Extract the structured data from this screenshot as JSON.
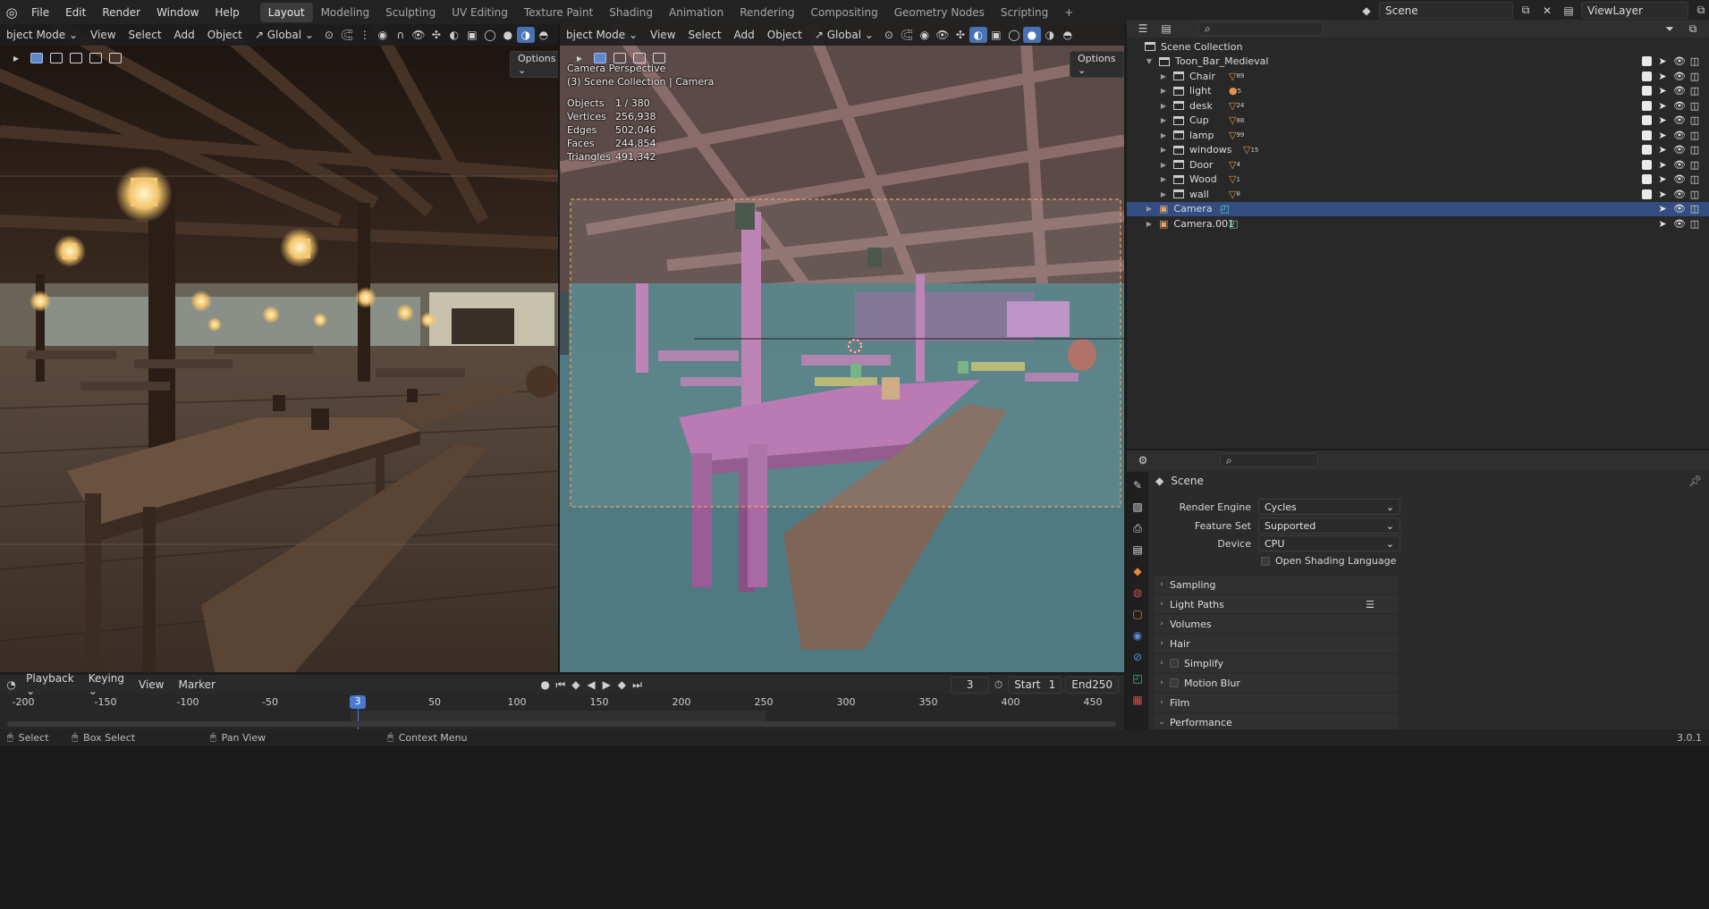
{
  "menu": [
    "File",
    "Edit",
    "Render",
    "Window",
    "Help"
  ],
  "workspaces": [
    "Layout",
    "Modeling",
    "Sculpting",
    "UV Editing",
    "Texture Paint",
    "Shading",
    "Animation",
    "Rendering",
    "Compositing",
    "Geometry Nodes",
    "Scripting"
  ],
  "active_workspace": "Layout",
  "add_workspace": "+",
  "scene_field": "Scene",
  "viewlayer_field": "ViewLayer",
  "viewport_left": {
    "mode": "bject Mode",
    "menus": [
      "View",
      "Select",
      "Add",
      "Object"
    ],
    "orientation": "Global",
    "options": "Options"
  },
  "viewport_right": {
    "mode": "bject Mode",
    "menus": [
      "View",
      "Select",
      "Add",
      "Object"
    ],
    "orientation": "Global",
    "options": "Options",
    "overlay_title": "Camera Perspective",
    "overlay_sub": "(3) Scene Collection | Camera",
    "stats": [
      {
        "label": "Objects",
        "value": "1 / 380"
      },
      {
        "label": "Vertices",
        "value": "256,938"
      },
      {
        "label": "Edges",
        "value": "502,046"
      },
      {
        "label": "Faces",
        "value": "244,854"
      },
      {
        "label": "Triangles",
        "value": "491,342"
      }
    ]
  },
  "outliner": {
    "root": "Scene Collection",
    "collection": "Toon_Bar_Medieval",
    "children": [
      {
        "name": "Chair",
        "count": "89"
      },
      {
        "name": "light",
        "count": "5"
      },
      {
        "name": "desk",
        "count": "24"
      },
      {
        "name": "Cup",
        "count": "88"
      },
      {
        "name": "lamp",
        "count": "99"
      },
      {
        "name": "windows",
        "count": "15"
      },
      {
        "name": "Door",
        "count": "4"
      },
      {
        "name": "Wood",
        "count": "1"
      },
      {
        "name": "wall",
        "count": "8"
      }
    ],
    "objects": [
      {
        "name": "Camera",
        "selected": true
      },
      {
        "name": "Camera.001",
        "selected": false
      }
    ]
  },
  "properties": {
    "header": "Scene",
    "fields": [
      {
        "label": "Render Engine",
        "value": "Cycles"
      },
      {
        "label": "Feature Set",
        "value": "Supported"
      },
      {
        "label": "Device",
        "value": "CPU"
      }
    ],
    "osl_label": "Open Shading Language",
    "panels": [
      "Sampling",
      "Light Paths",
      "Volumes",
      "Hair",
      "Simplify",
      "Motion Blur",
      "Film",
      "Performance"
    ]
  },
  "timeline": {
    "menus": [
      "Playback",
      "Keying",
      "View",
      "Marker"
    ],
    "current_frame": "3",
    "start_label": "Start",
    "start": "1",
    "end_label": "End",
    "end": "250",
    "ticks": [
      "-200",
      "-150",
      "-100",
      "-50",
      "50",
      "100",
      "150",
      "200",
      "250",
      "300",
      "350",
      "400",
      "450"
    ]
  },
  "status": {
    "select": "Select",
    "box_select": "Box Select",
    "pan_view": "Pan View",
    "context_menu": "Context Menu",
    "version": "3.0.1"
  },
  "colors": {
    "accent": "#4772b3",
    "selected_row": "#334d80",
    "camera_frame": "#e8a060",
    "frame_indicator": "#4a7ad0"
  }
}
